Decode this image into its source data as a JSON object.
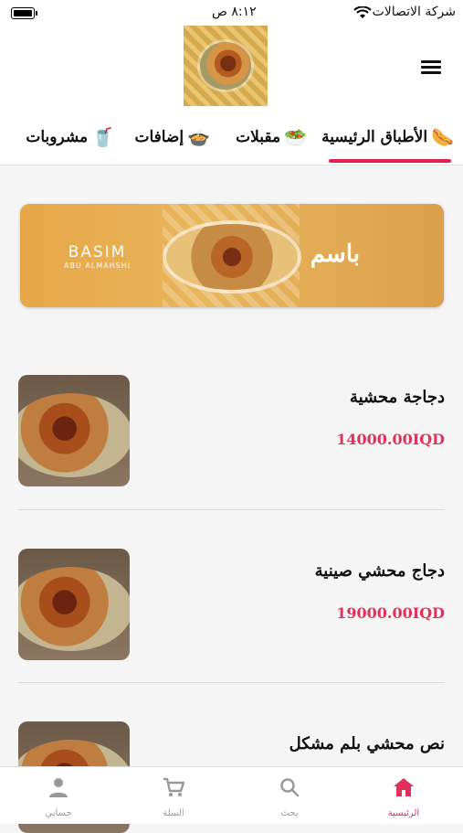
{
  "status_bar": {
    "carrier": "شركة الاتصالات",
    "time": "٨:١٢ ص"
  },
  "tabs": [
    {
      "label": "الأطباق الرئيسية",
      "emoji": "🌭"
    },
    {
      "label": "مقبلات",
      "emoji": "🥗"
    },
    {
      "label": "إضافات",
      "emoji": "🍲"
    },
    {
      "label": "مشروبات",
      "emoji": "🥤"
    }
  ],
  "banner": {
    "brand_en": "BASIM",
    "sub_en": "ABU ALMAHSHI",
    "brand_ar": "باسم"
  },
  "products": [
    {
      "name": "دجاجة محشية",
      "price": "14000.00IQD"
    },
    {
      "name": "دجاج محشي صينية",
      "price": "19000.00IQD"
    },
    {
      "name": "نص محشي بلم مشكل",
      "price": ""
    }
  ],
  "bottom_nav": {
    "home": "الرئيسية",
    "search": "بحث",
    "cart": "السلة",
    "account": "حسابي"
  },
  "colors": {
    "accent": "#e0315c",
    "tab_underline": "#e91e50"
  }
}
